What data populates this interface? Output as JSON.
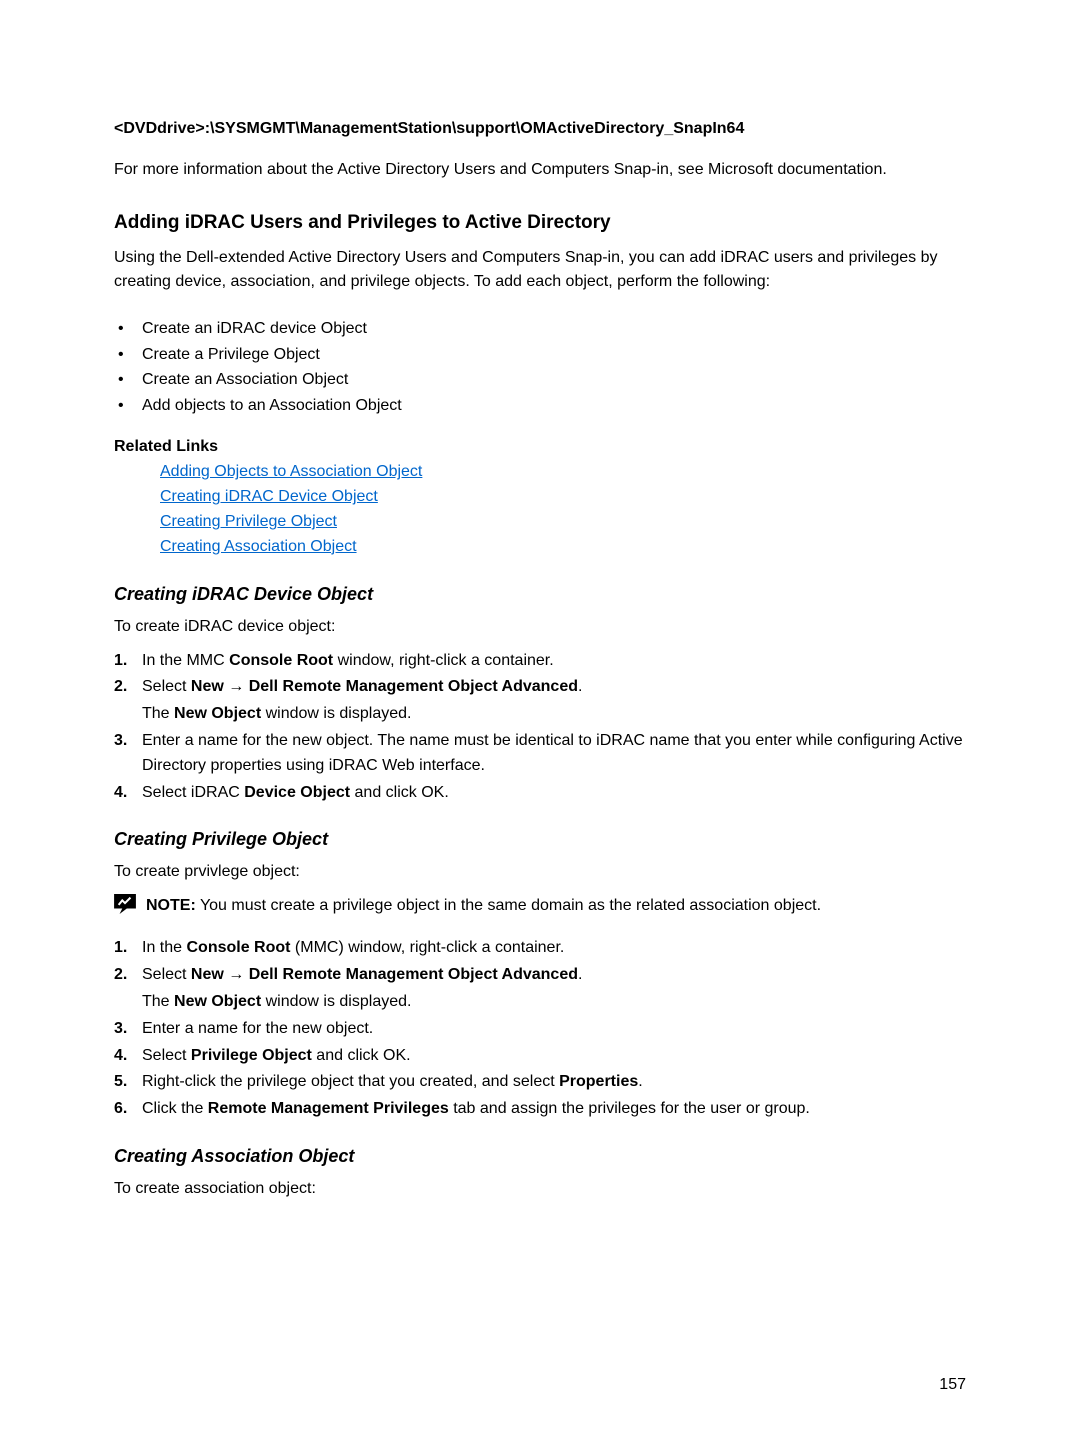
{
  "path": "<DVDdrive>:\\SYSMGMT\\ManagementStation\\support\\OMActiveDirectory_SnapIn64",
  "intro": "For more information about the Active Directory Users and Computers Snap-in, see Microsoft documentation.",
  "section1": {
    "title": "Adding iDRAC Users and Privileges to Active Directory",
    "para": "Using the Dell-extended Active Directory Users and Computers Snap-in, you can add iDRAC users and privileges by creating device, association, and privilege objects. To add each object, perform the following:",
    "bullets": [
      "Create an iDRAC device Object",
      "Create a Privilege Object",
      "Create an Association Object",
      "Add objects to an Association Object"
    ],
    "related_label": "Related Links",
    "links": [
      "Adding Objects to Association Object",
      "Creating iDRAC Device Object",
      "Creating Privilege Object",
      "Creating Association Object"
    ]
  },
  "section2": {
    "title": "Creating iDRAC Device Object",
    "intro": "To create iDRAC device object:",
    "steps": [
      {
        "pre": "In the MMC ",
        "b1": "Console Root",
        "post": " window, right-click a container."
      },
      {
        "pre": "Select ",
        "b1": "New",
        "arrow": " → ",
        "b2": "Dell Remote Management Object Advanced",
        "post": ".",
        "sub_pre": "The ",
        "sub_b": "New Object",
        "sub_post": " window is displayed."
      },
      {
        "pre": "Enter a name for the new object. The name must be identical to iDRAC name that you enter while configuring Active Directory properties using iDRAC Web interface."
      },
      {
        "pre": "Select iDRAC ",
        "b1": "Device Object",
        "post": " and click OK."
      }
    ]
  },
  "section3": {
    "title": "Creating Privilege Object",
    "intro": "To create prvivlege object:",
    "note_b": "NOTE:",
    "note": " You must create a privilege object in the same domain as the related association object.",
    "steps": [
      {
        "pre": "In the ",
        "b1": "Console Root",
        "post": " (MMC) window, right-click a container."
      },
      {
        "pre": "Select ",
        "b1": "New",
        "arrow": " → ",
        "b2": "Dell Remote Management Object Advanced",
        "post": ".",
        "sub_pre": "The ",
        "sub_b": "New Object",
        "sub_post": " window is displayed."
      },
      {
        "pre": "Enter a name for the new object."
      },
      {
        "pre": "Select ",
        "b1": "Privilege Object",
        "post": " and click OK."
      },
      {
        "pre": "Right-click the privilege object that you created, and select ",
        "b1": "Properties",
        "post": "."
      },
      {
        "pre": "Click the ",
        "b1": "Remote Management Privileges",
        "post": " tab and assign the privileges for the user or group."
      }
    ]
  },
  "section4": {
    "title": "Creating Association Object",
    "intro": "To create association object:"
  },
  "page_number": "157"
}
